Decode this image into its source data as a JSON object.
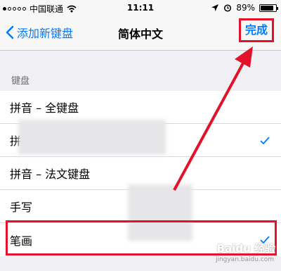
{
  "status_bar": {
    "carrier": "中国联通",
    "time": "11:11",
    "battery": "89%",
    "battery_level": 0.89,
    "signal_bars": 1
  },
  "nav": {
    "back_label": "添加新键盘",
    "title": "简体中文",
    "done_label": "完成"
  },
  "section_header": "键盘",
  "rows": [
    {
      "label": "拼音 – 全键盘",
      "checked": false
    },
    {
      "label": "拼",
      "checked": true
    },
    {
      "label": "拼音 – 法文键盘",
      "checked": false
    },
    {
      "label": "手写",
      "checked": false
    },
    {
      "label": "笔画",
      "checked": true
    }
  ],
  "watermark": {
    "text": "Baidu 经验",
    "url": "jingyan.baidu.com"
  },
  "colors": {
    "accent": "#007aff",
    "annotation": "#e3122a",
    "background": "#efeff4"
  }
}
